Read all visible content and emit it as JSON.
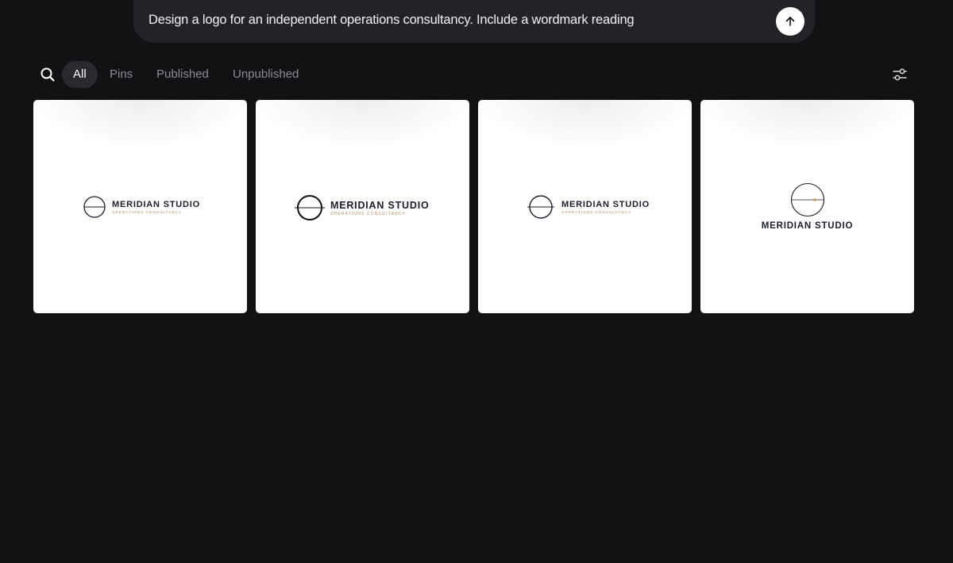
{
  "prompt": {
    "text": "Design a logo for an independent operations consultancy. Include a wordmark reading",
    "submit_icon": "arrow-up-icon"
  },
  "filters": {
    "search_icon": "search-icon",
    "tabs": [
      {
        "label": "All",
        "active": true
      },
      {
        "label": "Pins",
        "active": false
      },
      {
        "label": "Published",
        "active": false
      },
      {
        "label": "Unpublished",
        "active": false
      }
    ],
    "settings_icon": "sliders-icon"
  },
  "cards": [
    {
      "brand": "MERIDIAN STUDIO",
      "tagline": "OPERATIONS CONSULTANCY"
    },
    {
      "brand": "MERIDIAN STUDIO",
      "tagline": "OPERATIONS CONSULTANCY"
    },
    {
      "brand": "MERIDIAN STUDIO",
      "tagline": "OPERATIONS CONSULTANCY"
    },
    {
      "brand": "MERIDIAN STUDIO"
    }
  ],
  "colors": {
    "background": "#121114",
    "prompt_bar": "#232226",
    "brand_text": "#1b1d2a",
    "tagline_text": "#b08a5c",
    "accent_dot": "#c89a6a"
  }
}
